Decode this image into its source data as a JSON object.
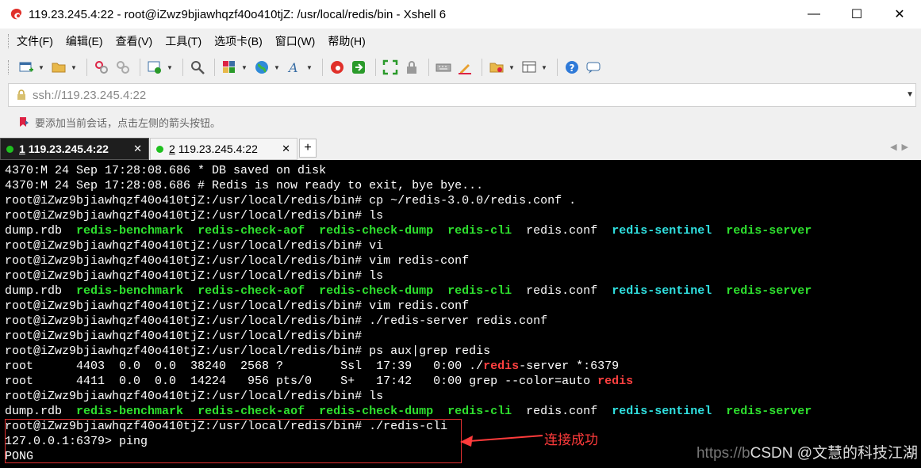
{
  "window": {
    "title": "119.23.245.4:22 - root@iZwz9bjiawhqzf40o410tjZ: /usr/local/redis/bin - Xshell 6",
    "minimize": "—",
    "maximize": "☐",
    "close": "✕"
  },
  "menu": [
    "文件(F)",
    "编辑(E)",
    "查看(V)",
    "工具(T)",
    "选项卡(B)",
    "窗口(W)",
    "帮助(H)"
  ],
  "toolbar_icons": [
    "new-session-icon",
    "open-folder-icon",
    "reconnect-icon",
    "disconnect-icon",
    "properties-icon",
    "find-icon",
    "copy-session-icon",
    "globe-icon",
    "font-icon",
    "xshell-icon",
    "xftp-icon",
    "fullscreen-icon",
    "lock-icon",
    "keyboard-icon",
    "highlight-icon",
    "script-icon",
    "layout-icon",
    "help-icon",
    "chat-icon"
  ],
  "address": {
    "value": "ssh://119.23.245.4:22"
  },
  "hint": "要添加当前会话，点击左侧的箭头按钮。",
  "tabs": [
    {
      "num": "1",
      "label": "119.23.245.4:22",
      "close": "✕",
      "status_color": "#1fc01f"
    },
    {
      "num": "2",
      "label": "119.23.245.4:22",
      "close": "✕",
      "status_color": "#1fc01f"
    }
  ],
  "tab_add": "+",
  "tab_nav": "◀▶",
  "terminal": {
    "lines": [
      [
        {
          "t": "4370:M 24 Sep 17:28:08.686 * DB saved on disk"
        }
      ],
      [
        {
          "t": "4370:M 24 Sep 17:28:08.686 # Redis is now ready to exit, bye bye..."
        }
      ],
      [
        {
          "t": "root@iZwz9bjiawhqzf40o410tjZ:/usr/local/redis/bin# cp ~/redis-3.0.0/redis.conf ."
        }
      ],
      [
        {
          "t": "root@iZwz9bjiawhqzf40o410tjZ:/usr/local/redis/bin# ls"
        }
      ],
      [
        {
          "t": "dump.rdb  "
        },
        {
          "t": "redis-benchmark",
          "c": "g"
        },
        {
          "t": "  "
        },
        {
          "t": "redis-check-aof",
          "c": "g"
        },
        {
          "t": "  "
        },
        {
          "t": "redis-check-dump",
          "c": "g"
        },
        {
          "t": "  "
        },
        {
          "t": "redis-cli",
          "c": "g"
        },
        {
          "t": "  redis.conf  "
        },
        {
          "t": "redis-sentinel",
          "c": "c"
        },
        {
          "t": "  "
        },
        {
          "t": "redis-server",
          "c": "g"
        }
      ],
      [
        {
          "t": "root@iZwz9bjiawhqzf40o410tjZ:/usr/local/redis/bin# vi"
        }
      ],
      [
        {
          "t": "root@iZwz9bjiawhqzf40o410tjZ:/usr/local/redis/bin# vim redis-conf"
        }
      ],
      [
        {
          "t": "root@iZwz9bjiawhqzf40o410tjZ:/usr/local/redis/bin# ls"
        }
      ],
      [
        {
          "t": "dump.rdb  "
        },
        {
          "t": "redis-benchmark",
          "c": "g"
        },
        {
          "t": "  "
        },
        {
          "t": "redis-check-aof",
          "c": "g"
        },
        {
          "t": "  "
        },
        {
          "t": "redis-check-dump",
          "c": "g"
        },
        {
          "t": "  "
        },
        {
          "t": "redis-cli",
          "c": "g"
        },
        {
          "t": "  redis.conf  "
        },
        {
          "t": "redis-sentinel",
          "c": "c"
        },
        {
          "t": "  "
        },
        {
          "t": "redis-server",
          "c": "g"
        }
      ],
      [
        {
          "t": "root@iZwz9bjiawhqzf40o410tjZ:/usr/local/redis/bin# vim redis.conf"
        }
      ],
      [
        {
          "t": "root@iZwz9bjiawhqzf40o410tjZ:/usr/local/redis/bin# ./redis-server redis.conf"
        }
      ],
      [
        {
          "t": "root@iZwz9bjiawhqzf40o410tjZ:/usr/local/redis/bin#"
        }
      ],
      [
        {
          "t": "root@iZwz9bjiawhqzf40o410tjZ:/usr/local/redis/bin# ps aux|grep redis"
        }
      ],
      [
        {
          "t": "root      4403  0.0  0.0  38240  2568 ?        Ssl  17:39   0:00 ./"
        },
        {
          "t": "redis",
          "c": "r"
        },
        {
          "t": "-server *:6379"
        }
      ],
      [
        {
          "t": "root      4411  0.0  0.0  14224   956 pts/0    S+   17:42   0:00 grep --color=auto "
        },
        {
          "t": "redis",
          "c": "r"
        }
      ],
      [
        {
          "t": "root@iZwz9bjiawhqzf40o410tjZ:/usr/local/redis/bin# ls"
        }
      ],
      [
        {
          "t": "dump.rdb  "
        },
        {
          "t": "redis-benchmark",
          "c": "g"
        },
        {
          "t": "  "
        },
        {
          "t": "redis-check-aof",
          "c": "g"
        },
        {
          "t": "  "
        },
        {
          "t": "redis-check-dump",
          "c": "g"
        },
        {
          "t": "  "
        },
        {
          "t": "redis-cli",
          "c": "g"
        },
        {
          "t": "  redis.conf  "
        },
        {
          "t": "redis-sentinel",
          "c": "c"
        },
        {
          "t": "  "
        },
        {
          "t": "redis-server",
          "c": "g"
        }
      ],
      [
        {
          "t": "root@iZwz9bjiawhqzf40o410tjZ:/usr/local/redis/bin# ./redis-cli"
        }
      ],
      [
        {
          "t": "127.0.0.1:6379> ping"
        }
      ],
      [
        {
          "t": "PONG"
        }
      ]
    ]
  },
  "annotation": {
    "label": "连接成功",
    "color": "#ff3b3b"
  },
  "watermark": {
    "faint": "https://b",
    "main": "CSDN @文慧的科技江湖"
  }
}
